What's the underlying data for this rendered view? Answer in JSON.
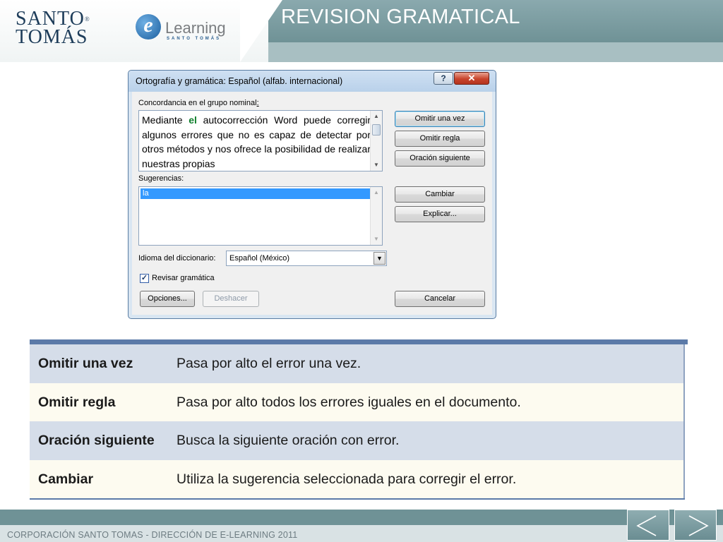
{
  "header": {
    "logo_line1": "SANTO",
    "logo_line2": "TOMÁS",
    "logo_reg": "®",
    "elearning_letter": "e",
    "elearning_word": "Learning",
    "elearning_sub": "SANTO TOMÁS",
    "title": "REVISION GRAMATICAL"
  },
  "dialog": {
    "title": "Ortografía y gramática: Español (alfab. internacional)",
    "help_glyph": "?",
    "close_glyph": "✕",
    "issue_label": "Concordancia en el grupo nominal",
    "issue_colon": ":",
    "text_before": "Mediante ",
    "text_highlight": "el",
    "text_after": " autocorrección Word puede corregir algunos errores que no es capaz de detectar por otros métodos y nos ofrece la posibilidad de realizar nuestras propias",
    "suggestions_label": "Sugerencias:",
    "suggestions": [
      "la"
    ],
    "language_label": "Idioma del diccionario:",
    "language_value": "Español (México)",
    "grammar_check_label": "Revisar gramática",
    "grammar_checked": true,
    "buttons": {
      "ignore_once": "Omitir una vez",
      "ignore_rule": "Omitir regla",
      "next_sentence": "Oración siguiente",
      "change": "Cambiar",
      "explain": "Explicar...",
      "options": "Opciones...",
      "undo": "Deshacer",
      "cancel": "Cancelar"
    }
  },
  "table": {
    "rows": [
      {
        "term": "Omitir una vez",
        "desc": "Pasa por alto el error una vez."
      },
      {
        "term": "Omitir regla",
        "desc": "Pasa por alto todos los errores iguales en el documento."
      },
      {
        "term": "Oración siguiente",
        "desc": "Busca la siguiente oración con error."
      },
      {
        "term": "Cambiar",
        "desc": "Utiliza la sugerencia seleccionada para corregir el error."
      }
    ]
  },
  "footer": {
    "text": "CORPORACIÓN SANTO TOMAS - DIRECCIÓN DE E-LEARNING  2011",
    "prev_glyph": "〈",
    "next_glyph": "〉"
  },
  "colors": {
    "brand_teal": "#6f9296",
    "brand_navy": "#1e3d5a",
    "table_header": "#5b7aa8",
    "table_row_blue": "#d5dde9",
    "table_row_cream": "#fdfbf0"
  }
}
